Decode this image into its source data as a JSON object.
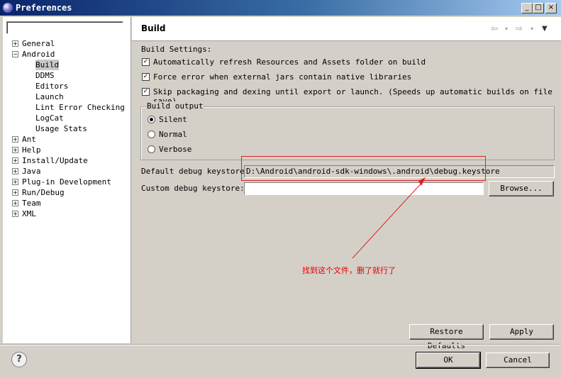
{
  "window": {
    "title": "Preferences",
    "controls": [
      "_",
      "□",
      "×"
    ]
  },
  "filter": {
    "value": ""
  },
  "tree": [
    {
      "label": "General",
      "expander": "+"
    },
    {
      "label": "Android",
      "expander": "−"
    },
    {
      "label": "Build",
      "selected": true
    },
    {
      "label": "DDMS"
    },
    {
      "label": "Editors"
    },
    {
      "label": "Launch"
    },
    {
      "label": "Lint Error Checking"
    },
    {
      "label": "LogCat"
    },
    {
      "label": "Usage Stats"
    },
    {
      "label": "Ant",
      "expander": "+"
    },
    {
      "label": "Help",
      "expander": "+"
    },
    {
      "label": "Install/Update",
      "expander": "+"
    },
    {
      "label": "Java",
      "expander": "+"
    },
    {
      "label": "Plug-in Development",
      "expander": "+"
    },
    {
      "label": "Run/Debug",
      "expander": "+"
    },
    {
      "label": "Team",
      "expander": "+"
    },
    {
      "label": "XML",
      "expander": "+"
    }
  ],
  "page": {
    "title": "Build",
    "nav": {
      "back": "⇦",
      "forward": "⇨",
      "menu": "▼"
    },
    "settings_label": "Build Settings:",
    "checks": [
      {
        "label": "Automatically refresh Resources and Assets folder on build",
        "checked": true
      },
      {
        "label": "Force error when external jars contain native libraries",
        "checked": true
      },
      {
        "label": "Skip packaging and dexing until export or launch. (Speeds up automatic builds on file save)",
        "checked": true
      }
    ],
    "output_group": "Build output",
    "radios": [
      {
        "label": "Silent",
        "selected": true
      },
      {
        "label": "Normal",
        "selected": false
      },
      {
        "label": "Verbose",
        "selected": false
      }
    ],
    "default_keystore_label": "Default debug keystore:",
    "default_keystore_value": "D:\\Android\\android-sdk-windows\\.android\\debug.keystore",
    "custom_keystore_label": "Custom debug keystore:",
    "custom_keystore_value": "",
    "browse": "Browse...",
    "restore": "Restore Defaults",
    "apply": "Apply"
  },
  "annotation": {
    "text": "找到这个文件，删了就行了",
    "color": "#e00000"
  },
  "footer": {
    "ok": "OK",
    "cancel": "Cancel",
    "help_icon": "?"
  }
}
